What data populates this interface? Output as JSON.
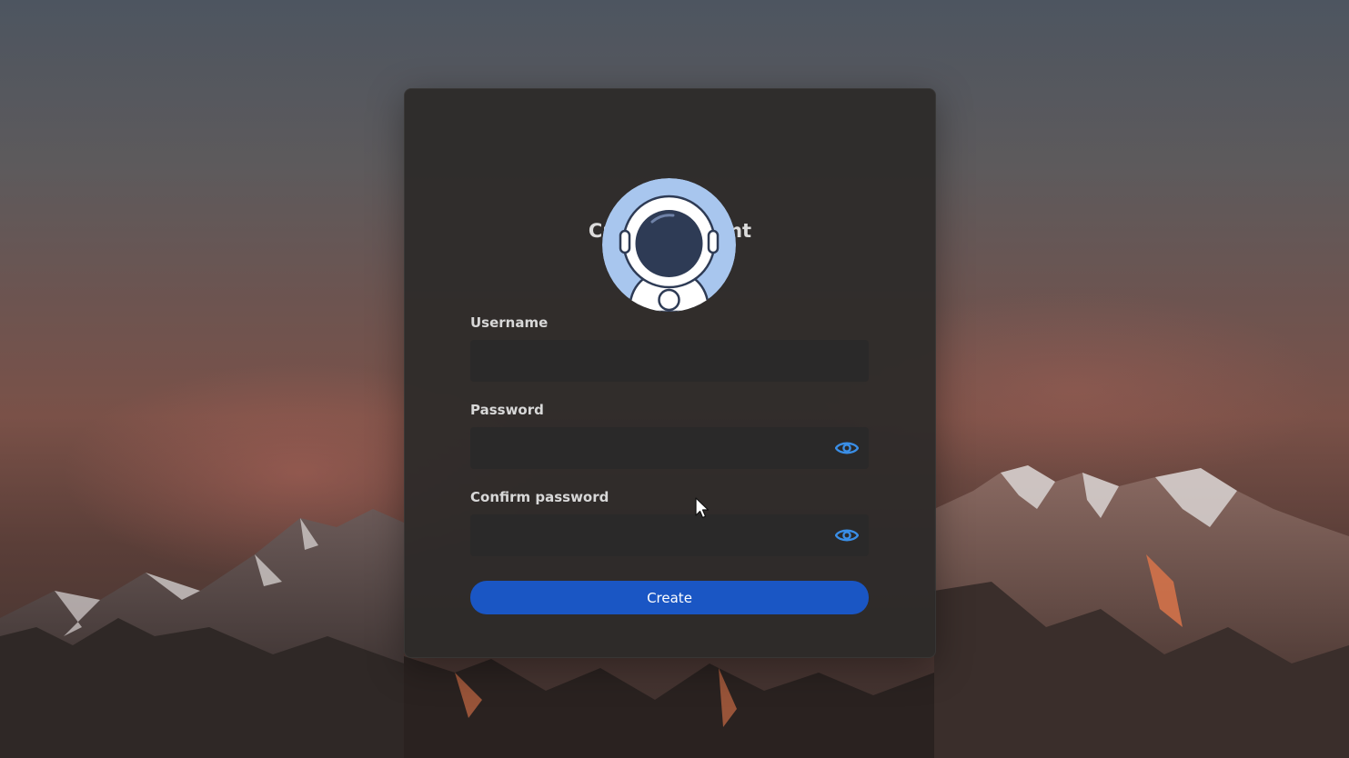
{
  "form": {
    "title": "Create account",
    "avatar_icon": "astronaut-icon",
    "username_label": "Username",
    "username_value": "",
    "password_label": "Password",
    "password_value": "",
    "password_toggle_icon": "eye-icon",
    "confirm_label": "Confirm password",
    "confirm_value": "",
    "confirm_toggle_icon": "eye-icon",
    "submit_label": "Create"
  },
  "colors": {
    "accent": "#1a56c4",
    "eye_icon": "#3a8ee6",
    "avatar_bg": "#a8c6ee",
    "helmet_visor": "#2e3b55"
  }
}
